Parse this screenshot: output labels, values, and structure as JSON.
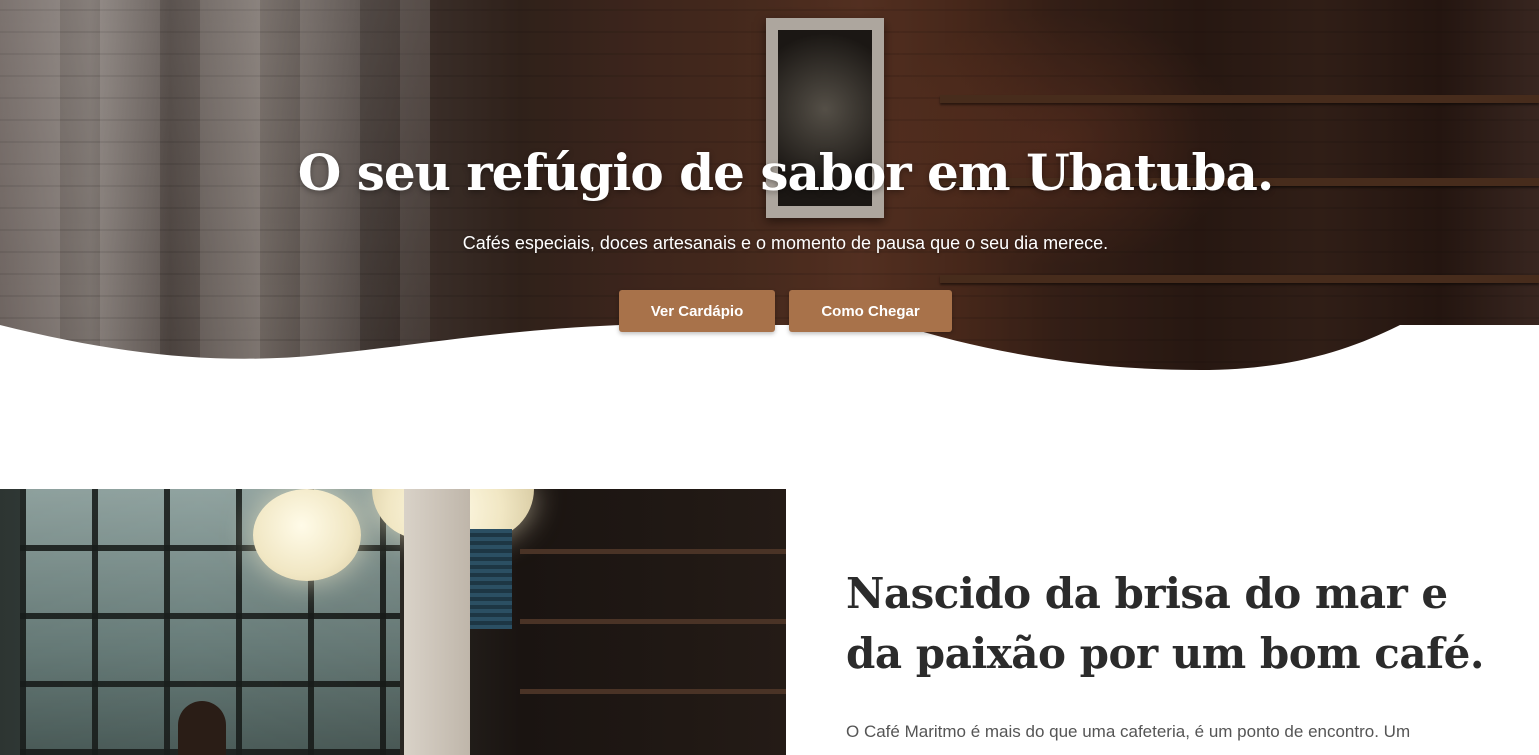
{
  "hero": {
    "title": "O seu refúgio de sabor em Ubatuba.",
    "subtitle": "Cafés especiais, doces artesanais e o momento de pausa que o seu dia merece.",
    "buttons": {
      "menu_label": "Ver Cardápio",
      "directions_label": "Como Chegar"
    }
  },
  "about": {
    "title": "Nascido da brisa do mar e da paixão por um bom café.",
    "text": "O Café Maritmo é mais do que uma cafeteria, é um ponto de encontro. Um"
  },
  "colors": {
    "accent": "#a8724a",
    "heading": "#2b2b2b",
    "body_text": "#555555",
    "background": "#ffffff"
  }
}
